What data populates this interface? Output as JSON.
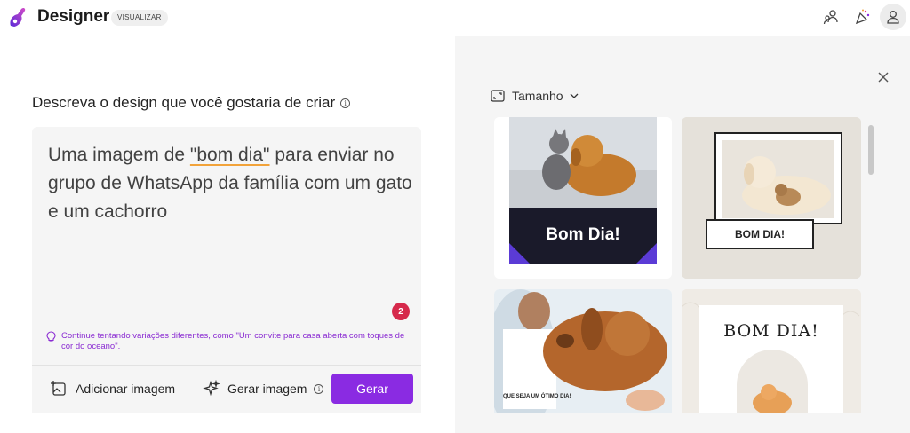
{
  "app": {
    "title": "Designer",
    "badge": "VISUALIZAR",
    "accent": "#8a2be2"
  },
  "toolbar": {
    "icons": [
      "person-switch-icon",
      "celebration-bell-icon",
      "account-icon"
    ]
  },
  "prompt": {
    "heading": "Descreva o design que você gostaria de criar",
    "text_part1": "Uma imagem de ",
    "text_mark1": "\"bom dia\"",
    "text_part2": " para enviar no grupo de WhatsApp da família com um gato e um cachorro",
    "count": "2",
    "suggestion": "Continue tentando variações diferentes, como \"Um convite para casa aberta com toques de cor do oceano\"."
  },
  "actions": {
    "add_image": "Adicionar imagem",
    "generate_image": "Gerar imagem",
    "generate": "Gerar"
  },
  "results": {
    "size_label": "Tamanho",
    "cards": [
      {
        "caption": "Bom Dia!"
      },
      {
        "caption": "BOM DIA!"
      },
      {
        "caption": "QUE SEJA UM ÓTIMO DIA!"
      },
      {
        "caption": "BOM DIA!"
      }
    ]
  }
}
